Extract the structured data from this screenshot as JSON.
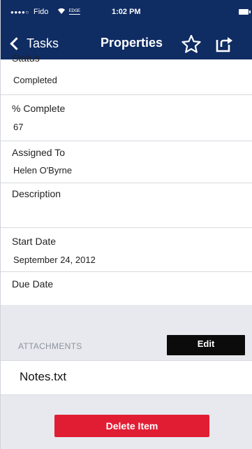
{
  "status_bar": {
    "signal": "●●●●○",
    "carrier": "Fido",
    "network": "ᴱᴰᴳᴱ",
    "time": "1:02 PM"
  },
  "nav": {
    "back_label": "Tasks",
    "title": "Properties",
    "star_icon": "star-outline",
    "share_icon": "share-edit"
  },
  "properties": {
    "status": {
      "label": "Status",
      "value": "Completed"
    },
    "percent_complete": {
      "label": "% Complete",
      "value": "67"
    },
    "assigned_to": {
      "label": "Assigned To",
      "value": "Helen O'Byrne"
    },
    "description": {
      "label": "Description",
      "value": ""
    },
    "start_date": {
      "label": "Start Date",
      "value": "September 24, 2012"
    },
    "due_date": {
      "label": "Due Date",
      "value": ""
    }
  },
  "attachments": {
    "header": "ATTACHMENTS",
    "edit_label": "Edit",
    "items": [
      {
        "name": "Notes.txt"
      }
    ]
  },
  "actions": {
    "delete_label": "Delete Item"
  },
  "colors": {
    "nav_bg": "#0f2c63",
    "delete_bg": "#e11d34",
    "edit_bg": "#0b0b0b",
    "grey_bg": "#e7e9ee"
  }
}
